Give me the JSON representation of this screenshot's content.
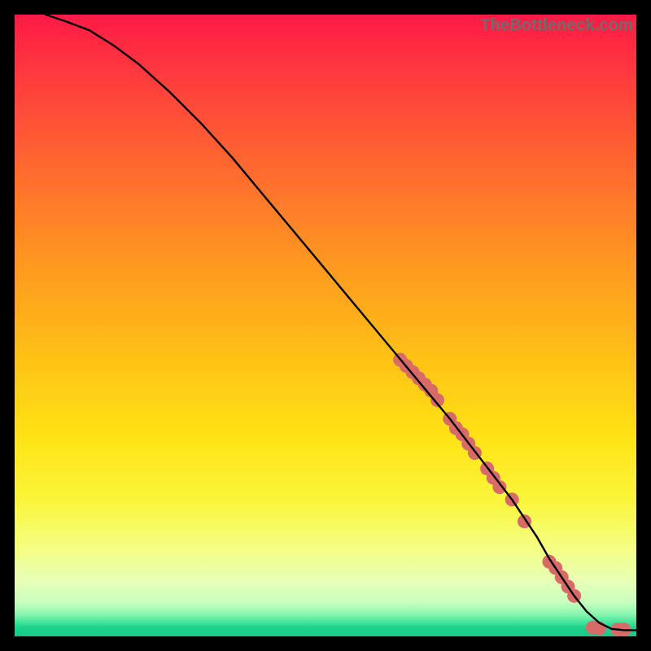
{
  "watermark": "TheBottleneck.com",
  "colors": {
    "black": "#000000",
    "curve": "#000000",
    "dot": "#d86a68",
    "gradient_stops": [
      {
        "offset": 0.0,
        "color": "#ff1a46"
      },
      {
        "offset": 0.1,
        "color": "#ff3b3e"
      },
      {
        "offset": 0.25,
        "color": "#ff6a2f"
      },
      {
        "offset": 0.4,
        "color": "#ff9820"
      },
      {
        "offset": 0.55,
        "color": "#ffc016"
      },
      {
        "offset": 0.68,
        "color": "#ffe315"
      },
      {
        "offset": 0.78,
        "color": "#fbf53a"
      },
      {
        "offset": 0.86,
        "color": "#f4ff84"
      },
      {
        "offset": 0.91,
        "color": "#e8ffb6"
      },
      {
        "offset": 0.945,
        "color": "#c9ffbf"
      },
      {
        "offset": 0.965,
        "color": "#86f5ad"
      },
      {
        "offset": 0.978,
        "color": "#40e39a"
      },
      {
        "offset": 0.985,
        "color": "#1fd48f"
      },
      {
        "offset": 1.0,
        "color": "#15c988"
      }
    ]
  },
  "chart_data": {
    "type": "line",
    "title": "",
    "xlabel": "",
    "ylabel": "",
    "xlim": [
      0,
      100
    ],
    "ylim": [
      0,
      100
    ],
    "grid": false,
    "legend": null,
    "series": [
      {
        "name": "bottleneck-curve",
        "x": [
          5,
          8,
          12,
          16,
          20,
          25,
          30,
          35,
          40,
          45,
          50,
          55,
          60,
          65,
          70,
          75,
          80,
          84,
          86,
          88,
          90,
          92,
          94,
          96,
          98,
          100
        ],
        "y": [
          100,
          99,
          97.5,
          95,
          92,
          87.5,
          82.5,
          77,
          71,
          65,
          59,
          53,
          47,
          41,
          35,
          28.5,
          22,
          16,
          12.5,
          9.5,
          6.5,
          4,
          2.2,
          1.2,
          1,
          1
        ]
      }
    ],
    "highlight_points": {
      "name": "highlight-dots",
      "x": [
        62,
        63,
        64,
        65,
        66,
        67,
        68,
        70,
        71,
        72,
        73,
        74,
        76,
        77,
        78,
        80,
        82,
        86,
        87,
        88,
        89,
        90,
        93,
        94,
        97,
        98
      ],
      "y": [
        44.5,
        43.5,
        42.5,
        41.5,
        40.5,
        39.5,
        38,
        35,
        33.5,
        32.5,
        31,
        29.5,
        27,
        25.5,
        24,
        22,
        18.5,
        12,
        11,
        9.5,
        8,
        6.5,
        1.4,
        1.3,
        1.1,
        1.1
      ]
    }
  }
}
